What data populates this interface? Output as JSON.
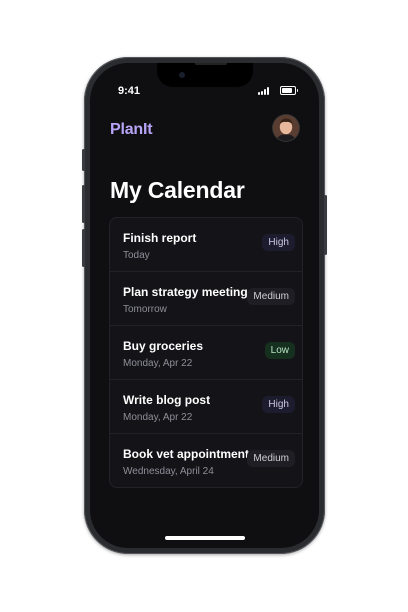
{
  "status": {
    "time": "9:41"
  },
  "app": {
    "brand": "PlanIt",
    "page_title": "My Calendar"
  },
  "tasks": [
    {
      "title": "Finish report",
      "date": "Today",
      "priority": "High",
      "level": "high"
    },
    {
      "title": "Plan strategy meeting",
      "date": "Tomorrow",
      "priority": "Medium",
      "level": "medium"
    },
    {
      "title": "Buy groceries",
      "date": "Monday, Apr 22",
      "priority": "Low",
      "level": "low"
    },
    {
      "title": "Write blog post",
      "date": "Monday, Apr 22",
      "priority": "High",
      "level": "high"
    },
    {
      "title": "Book vet appointment",
      "date": "Wednesday, April 24",
      "priority": "Medium",
      "level": "medium"
    }
  ],
  "colors": {
    "brand": "#b7a4f7",
    "background": "#0f0f12",
    "card": "#141418"
  }
}
